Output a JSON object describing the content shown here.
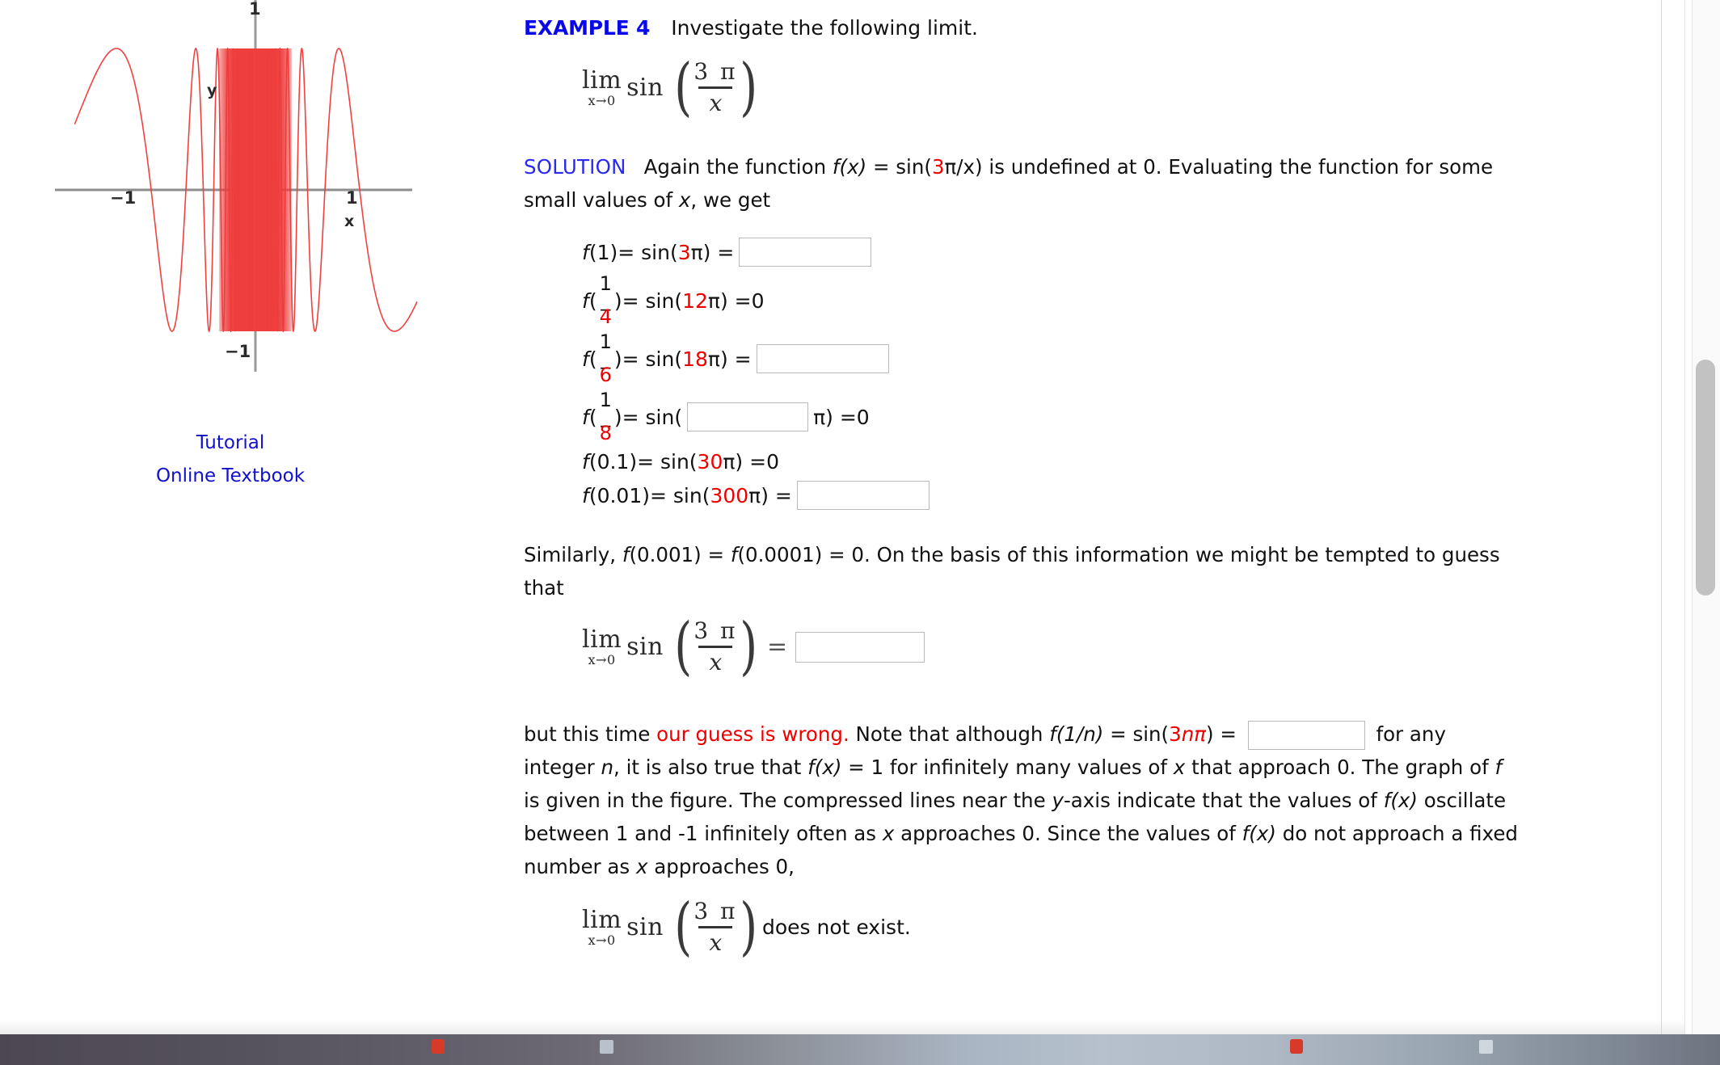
{
  "example": {
    "label": "EXAMPLE 4",
    "prompt": "Investigate the following limit."
  },
  "limit_expr": {
    "lim": "lim",
    "sub": "x→0",
    "sin": "sin",
    "numer": "3 π",
    "denom": "x",
    "paren_open": "(",
    "paren_close": ")"
  },
  "solution": {
    "label": "SOLUTION",
    "text_a": "Again the function ",
    "fx": "f(x)",
    "text_b": " = sin(",
    "red_three": "3",
    "text_c": "π/x) is undefined at 0. Evaluating the function for some small values of ",
    "x_ital": "x",
    "text_d": ", we get"
  },
  "evaluations": [
    {
      "lhs_f": "f",
      "lhs_open": "(1)",
      "mid": " = sin(",
      "coef": "3",
      "pi_close": "π) = ",
      "has_box": true,
      "box_value": "",
      "result": ""
    },
    {
      "lhs_f": "f",
      "frac_num": "1",
      "frac_dash": "_",
      "frac_den": "4",
      "mid": " = sin(",
      "coef": "12",
      "pi_close": "π) = ",
      "has_box": false,
      "result": "0"
    },
    {
      "lhs_f": "f",
      "frac_num": "1",
      "frac_dash": "_",
      "frac_den": "6",
      "mid": " = sin(",
      "coef": "18",
      "pi_close": "π) = ",
      "has_box": true,
      "box_value": "",
      "result": ""
    },
    {
      "lhs_f": "f",
      "frac_num": "1",
      "frac_dash": "_",
      "frac_den": "8",
      "mid": " = sin(",
      "coef": "",
      "box_value": "",
      "pi_close": "π) = ",
      "has_box": true,
      "box_inside": true,
      "result": "0"
    },
    {
      "lhs_f": "f",
      "lhs_open": "(0.1)",
      "mid": " = sin(",
      "coef": "30",
      "pi_close": "π) = ",
      "has_box": false,
      "result": "0"
    },
    {
      "lhs_f": "f",
      "lhs_open": "(0.01)",
      "mid": " = sin(",
      "coef": "300",
      "pi_close": "π) = ",
      "has_box": true,
      "box_value": "",
      "result": ""
    }
  ],
  "similarly": {
    "a": "Similarly, ",
    "f1": "f",
    "f1v": "(0.001)",
    "b": " = ",
    "f2": "f",
    "f2v": "(0.0001)",
    "c": " = 0. On the basis of this information we might be tempted to guess that"
  },
  "guess_equals": "=",
  "guess_box_value": "",
  "wrong_para": {
    "a": "but this time ",
    "red": "our guess is wrong.",
    "b": " Note that although ",
    "f1": "f",
    "f1v": "(1/n)",
    "c": " = sin(",
    "red3": "3",
    "np": "nπ",
    "d": ") = ",
    "box_value": "",
    "e": " for any integer ",
    "n_it": "n",
    "f": ", it is also true that ",
    "fx2": "f(x)",
    "g": " = 1 for infinitely many values of ",
    "x1": "x",
    "h": " that approach 0. The graph of ",
    "f_it": "f",
    "i": " is given in the figure. The compressed lines near the ",
    "y_it": "y",
    "j": "-axis indicate that the values of ",
    "fx3": "f(x)",
    "k": " oscillate between 1 and -1 infinitely often as ",
    "x2": "x",
    "l": " approaches 0. Since the values of ",
    "fx4": "f(x)",
    "m": " do not approach a fixed number as ",
    "x3": "x",
    "n": " approaches 0,"
  },
  "dne_text": "does not exist.",
  "links": [
    {
      "label": "Tutorial"
    },
    {
      "label": "Online Textbook"
    }
  ],
  "chart_data": {
    "type": "line",
    "title": "",
    "function": "f(x) = sin(3π/x)",
    "xlabel": "x",
    "ylabel": "y",
    "xlim": [
      -2.6,
      2.6
    ],
    "ylim": [
      -1.25,
      1.25
    ],
    "x_ticks": [
      -1,
      1
    ],
    "x_tick_labels": [
      "−1",
      "1"
    ],
    "y_ticks": [
      -1,
      1
    ],
    "y_tick_labels": [
      "−1",
      "1"
    ],
    "grid": false,
    "legend": "none",
    "curve_color": "#f04040",
    "axis_color": "#8a8a8a",
    "notes": "Oscillation compresses infinitely near x = 0; amplitude 1",
    "series": [
      {
        "name": "sin(3π/x)",
        "color": "#f04040",
        "description": "Densely oscillating sinusoid; period shrinks toward x=0"
      }
    ]
  },
  "colors": {
    "accent_blue": "#0808e8",
    "link_blue": "#1111cc",
    "highlight_red": "#ee0000",
    "curve_red": "#f04040",
    "text": "#111111",
    "box_border": "#b9b9b9"
  }
}
